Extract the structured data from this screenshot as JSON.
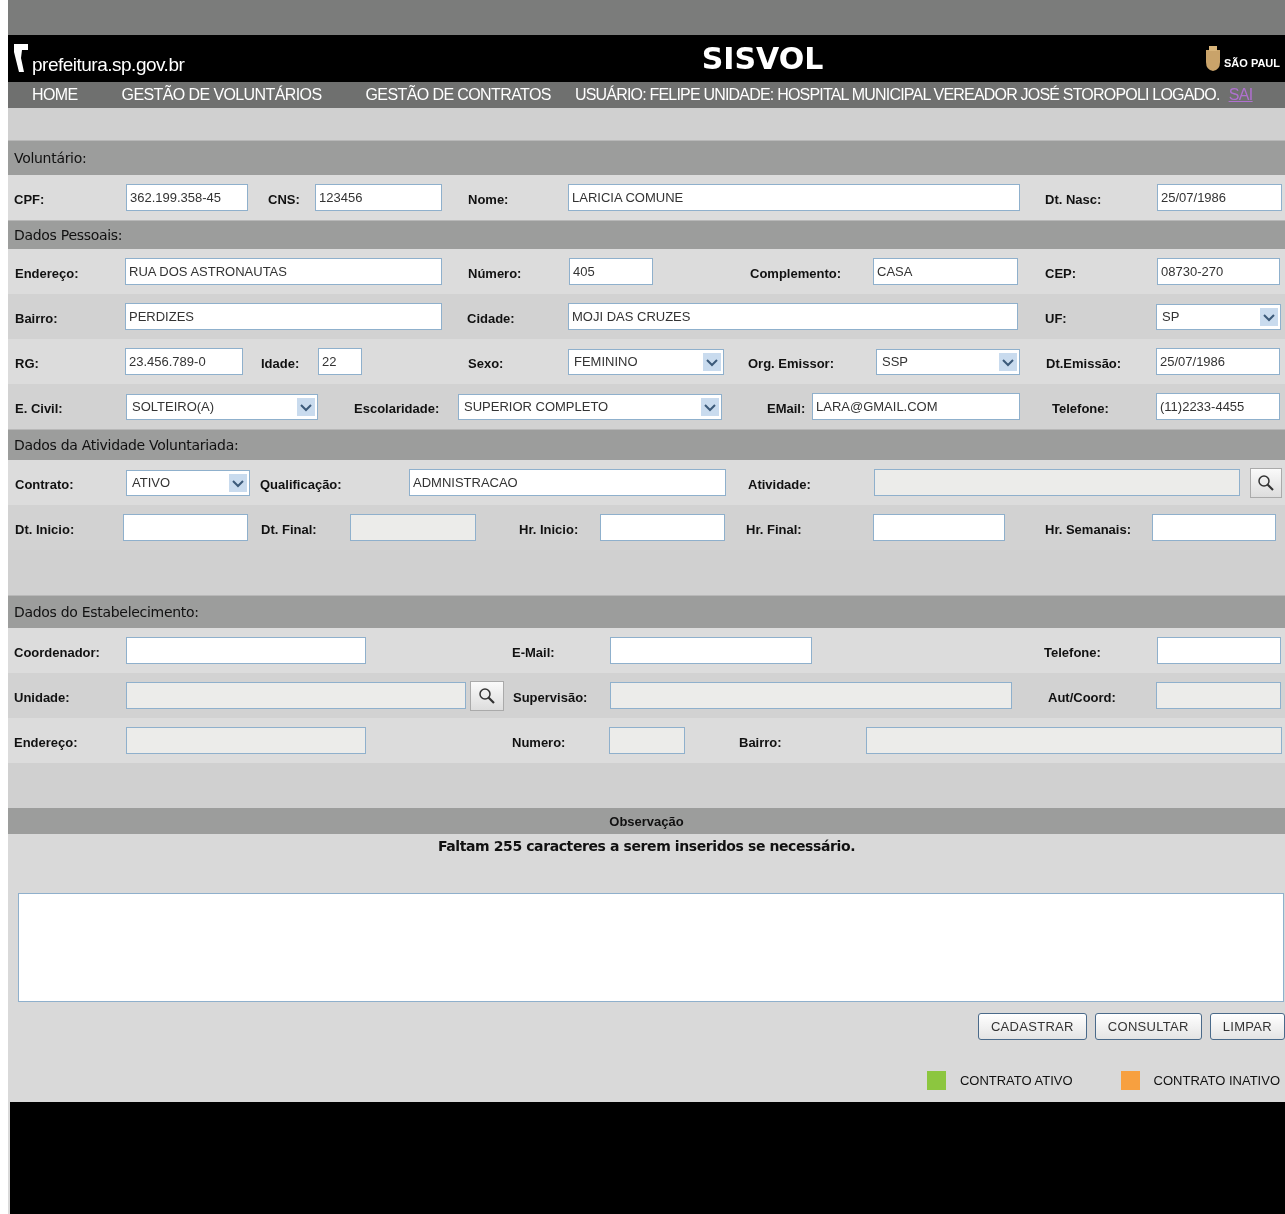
{
  "header": {
    "logo": "prefeitura.sp.gov.br",
    "title": "SISVOL",
    "city": "SÃO PAUL"
  },
  "nav": {
    "items": [
      "HOME",
      "GESTÃO DE VOLUNTÁRIOS",
      "GESTÃO DE CONTRATOS"
    ],
    "user": "USUÁRIO: FELIPE UNIDADE: HOSPITAL MUNICIPAL VEREADOR JOSÉ STOROPOLI LOGADO.",
    "logout": "SAI"
  },
  "sections": [
    {
      "title": "Voluntário:",
      "lines": [
        {
          "fields": [
            {
              "label": "CPF:",
              "kind": "text",
              "value": "362.199.358-45"
            },
            {
              "label": "CNS:",
              "kind": "text",
              "value": "123456"
            },
            {
              "label": "Nome:",
              "kind": "text",
              "value": "LARICIA COMUNE"
            },
            {
              "label": "Dt. Nasc:",
              "kind": "text",
              "value": "25/07/1986"
            }
          ]
        }
      ]
    },
    {
      "title": "Dados Pessoais:",
      "lines": [
        {
          "fields": [
            {
              "label": "Endereço:",
              "kind": "text",
              "value": "RUA DOS ASTRONAUTAS"
            },
            {
              "label": "Número:",
              "kind": "text",
              "value": "405"
            },
            {
              "label": "Complemento:",
              "kind": "text",
              "value": "CASA"
            },
            {
              "label": "CEP:",
              "kind": "text",
              "value": "08730-270"
            }
          ]
        },
        {
          "fields": [
            {
              "label": "Bairro:",
              "kind": "text",
              "value": "PERDIZES"
            },
            {
              "label": "Cidade:",
              "kind": "text",
              "value": "MOJI DAS CRUZES"
            },
            {
              "label": "UF:",
              "kind": "select",
              "value": "SP"
            }
          ]
        },
        {
          "fields": [
            {
              "label": "RG:",
              "kind": "text",
              "value": "23.456.789-0"
            },
            {
              "label": "Idade:",
              "kind": "text",
              "value": "22"
            },
            {
              "label": "Sexo:",
              "kind": "select",
              "value": "FEMININO"
            },
            {
              "label": "Org. Emissor:",
              "kind": "select",
              "value": "SSP"
            },
            {
              "label": "Dt.Emissão:",
              "kind": "text",
              "value": "25/07/1986"
            }
          ]
        },
        {
          "fields": [
            {
              "label": "E. Civil:",
              "kind": "select",
              "value": "SOLTEIRO(A)"
            },
            {
              "label": "Escolaridade:",
              "kind": "select",
              "value": "SUPERIOR COMPLETO"
            },
            {
              "label": "EMail:",
              "kind": "text",
              "value": "LARA@GMAIL.COM"
            },
            {
              "label": "Telefone:",
              "kind": "text",
              "value": "(11)2233-4455"
            }
          ]
        }
      ]
    },
    {
      "title": "Dados da Atividade Voluntariada:",
      "lines": [
        {
          "fields": [
            {
              "label": "Contrato:",
              "kind": "select",
              "value": "ATIVO"
            },
            {
              "label": "Qualificação:",
              "kind": "text",
              "value": "ADMNISTRACAO"
            },
            {
              "label": "Atividade:",
              "kind": "readonly"
            },
            {
              "kind": "search"
            }
          ]
        },
        {
          "fields": [
            {
              "label": "Dt. Inicio:",
              "kind": "text"
            },
            {
              "label": "Dt. Final:",
              "kind": "readonly"
            },
            {
              "label": "Hr. Inicio:",
              "kind": "text"
            },
            {
              "label": "Hr. Final:",
              "kind": "text"
            },
            {
              "label": "Hr. Semanais:",
              "kind": "text"
            }
          ]
        }
      ]
    },
    {
      "title": "Dados do Estabelecimento:",
      "lines": [
        {
          "fields": [
            {
              "label": "Coordenador:",
              "kind": "text"
            },
            {
              "label": "E-Mail:",
              "kind": "text"
            },
            {
              "label": "Telefone:",
              "kind": "text"
            }
          ]
        },
        {
          "fields": [
            {
              "label": "Unidade:",
              "kind": "readonly"
            },
            {
              "kind": "search"
            },
            {
              "label": "Supervisão:",
              "kind": "readonly"
            },
            {
              "label": "Aut/Coord:",
              "kind": "readonly"
            }
          ]
        },
        {
          "fields": [
            {
              "label": "Endereço:",
              "kind": "readonly"
            },
            {
              "label": "Numero:",
              "kind": "readonly"
            },
            {
              "label": "Bairro:",
              "kind": "readonly"
            }
          ]
        }
      ]
    }
  ],
  "observation": {
    "title": "Observação",
    "counter": "Faltam 255 caracteres a serem inseridos se necessário."
  },
  "buttons": [
    "CADASTRAR",
    "CONSULTAR",
    "LIMPAR"
  ],
  "legend": [
    {
      "label": "CONTRATO ATIVO",
      "color": "#8cc63f"
    },
    {
      "label": "CONTRATO INATIVO",
      "color": "#f7a040"
    }
  ]
}
